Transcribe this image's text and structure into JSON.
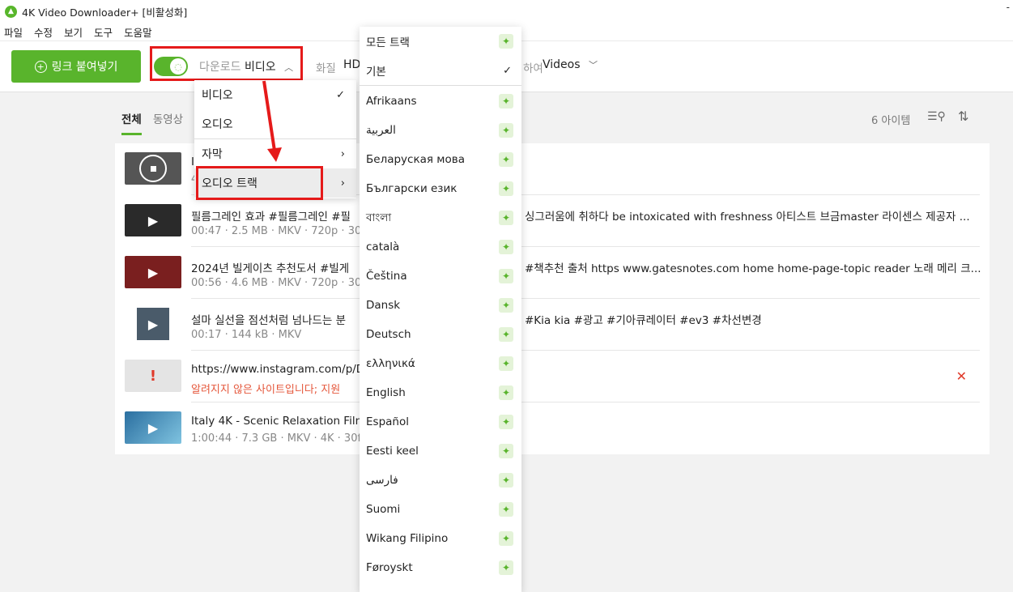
{
  "window": {
    "title": "4K Video Downloader+ [비활성화]",
    "minimize": "-"
  },
  "menu": [
    "파일",
    "수정",
    "보기",
    "도구",
    "도움말"
  ],
  "toolbar": {
    "paste_label": "링크 붙여넣기",
    "mode_prefix": "다운로드",
    "mode_value": "비디오",
    "quality_label": "화질",
    "quality_value": "HD",
    "folder_label": "하여",
    "folder_value": "Videos"
  },
  "tabs": {
    "all": "전체",
    "video": "동영상"
  },
  "list_header": {
    "count": "6 아이템"
  },
  "rows": [
    {
      "title": "I",
      "meta": "4"
    },
    {
      "title": "필름그레인 효과 #필름그레인 #필",
      "meta": "00:47 · 2.5 MB · MKV · 720p · 30f",
      "desc": "싱그러움에 취하다 be intoxicated with freshness 아티스트 브금master 라이센스 제공자 ..."
    },
    {
      "title": "2024년 빌게이츠 추천도서 #빌게",
      "meta": "00:56 · 4.6 MB · MKV · 720p · 30f",
      "desc": "#책추천 출처 https www.gatesnotes.com home home-page-topic reader 노래 메리 크..."
    },
    {
      "title": "설마 실선을 점선처럼 넘나드는 분",
      "meta": "00:17 · 144 kB · MKV",
      "desc": "#Kia kia #광고 #기아큐레이터 #ev3 #차선변경"
    },
    {
      "title": "https://www.instagram.com/p/DD",
      "meta": "알려지지 않은 사이트입니다; 지원"
    },
    {
      "title": "Italy 4K - Scenic Relaxation Film W",
      "meta": "1:00:44 · 7.3 GB · MKV · 4K · 30fp"
    }
  ],
  "dropdown": {
    "items": [
      "비디오",
      "오디오",
      "자막",
      "오디오 트랙"
    ]
  },
  "submenu": {
    "top": [
      "모든 트랙",
      "기본"
    ],
    "languages": [
      "Afrikaans",
      "العربية",
      "Беларуская мова",
      "Български език",
      "বাংলা",
      "català",
      "Čeština",
      "Dansk",
      "Deutsch",
      "ελληνικά",
      "English",
      "Español",
      "Eesti keel",
      "فارسی",
      "Suomi",
      "Wikang Filipino",
      "Føroyskt"
    ]
  },
  "colors": {
    "accent": "#59b42c",
    "highlight": "#e51a1a",
    "error": "#e5573b"
  }
}
